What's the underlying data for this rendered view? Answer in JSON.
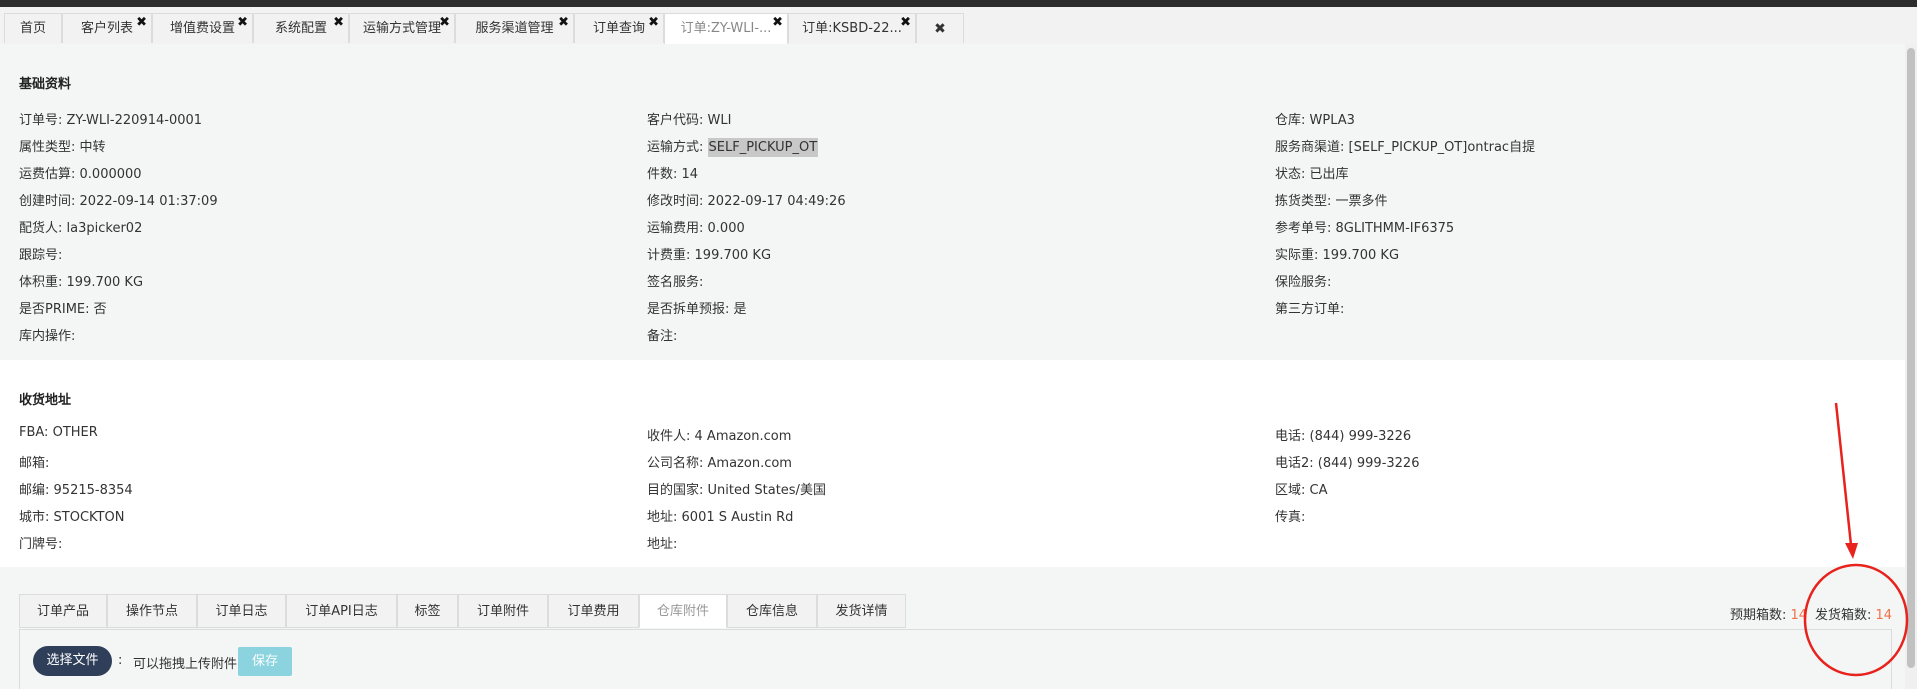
{
  "tabs": [
    {
      "label": "首页",
      "closable": false
    },
    {
      "label": "客户列表",
      "closable": true
    },
    {
      "label": "增值费设置",
      "closable": true
    },
    {
      "label": "系统配置",
      "closable": true
    },
    {
      "label": "运输方式管理",
      "closable": true
    },
    {
      "label": "服务渠道管理",
      "closable": true
    },
    {
      "label": "订单查询",
      "closable": true
    },
    {
      "label": "订单:ZY-WLI-...",
      "closable": true,
      "active": true
    },
    {
      "label": "订单:KSBD-22...",
      "closable": true
    },
    {
      "label": "✖",
      "closable": false
    }
  ],
  "close_glyph": "✖",
  "basic": {
    "title": "基础资料",
    "col1": [
      {
        "label": "订单号:",
        "value": "ZY-WLI-220914-0001"
      },
      {
        "label": "属性类型:",
        "value": "中转"
      },
      {
        "label": "运费估算:",
        "value": "0.000000"
      },
      {
        "label": "创建时间:",
        "value": "2022-09-14 01:37:09"
      },
      {
        "label": "配货人:",
        "value": "la3picker02"
      },
      {
        "label": "跟踪号:",
        "value": ""
      },
      {
        "label": "体积重:",
        "value": "199.700 KG"
      },
      {
        "label": "是否PRIME:",
        "value": "否"
      },
      {
        "label": "库内操作:",
        "value": ""
      }
    ],
    "col2": [
      {
        "label": "客户代码:",
        "value": "WLI"
      },
      {
        "label": "运输方式:",
        "value": "SELF_PICKUP_OT"
      },
      {
        "label": "件数:",
        "value": "14"
      },
      {
        "label": "修改时间:",
        "value": "2022-09-17 04:49:26"
      },
      {
        "label": "运输费用:",
        "value": "0.000"
      },
      {
        "label": "计费重:",
        "value": "199.700 KG"
      },
      {
        "label": "签名服务:",
        "value": ""
      },
      {
        "label": "是否拆单预报:",
        "value": "是"
      },
      {
        "label": "备注:",
        "value": ""
      }
    ],
    "col3": [
      {
        "label": "仓库:",
        "value": "WPLA3"
      },
      {
        "label": "服务商渠道:",
        "value": "[SELF_PICKUP_OT]ontrac自提"
      },
      {
        "label": "状态:",
        "value": "已出库"
      },
      {
        "label": "拣货类型:",
        "value": "一票多件"
      },
      {
        "label": "参考单号:",
        "value": "8GLITHMM-IF6375"
      },
      {
        "label": "实际重:",
        "value": "199.700 KG"
      },
      {
        "label": "保险服务:",
        "value": ""
      },
      {
        "label": "第三方订单:",
        "value": ""
      }
    ]
  },
  "address": {
    "title": "收货地址",
    "col1": [
      {
        "label": "FBA:",
        "value": "OTHER"
      },
      {
        "label": "邮箱:",
        "value": ""
      },
      {
        "label": "邮编:",
        "value": "95215-8354"
      },
      {
        "label": "城市:",
        "value": "STOCKTON"
      },
      {
        "label": "门牌号:",
        "value": ""
      }
    ],
    "col2": [
      {
        "label": "收件人:",
        "value": "4 Amazon.com"
      },
      {
        "label": "公司名称:",
        "value": "Amazon.com"
      },
      {
        "label": "目的国家:",
        "value": "United States/美国"
      },
      {
        "label": "地址:",
        "value": "6001 S Austin Rd"
      },
      {
        "label": "地址:",
        "value": ""
      }
    ],
    "col3": [
      {
        "label": "电话:",
        "value": "(844) 999-3226"
      },
      {
        "label": "电话2:",
        "value": "(844) 999-3226"
      },
      {
        "label": "区域:",
        "value": "CA"
      },
      {
        "label": "传真:",
        "value": ""
      }
    ]
  },
  "bottom_tabs": [
    "订单产品",
    "操作节点",
    "订单日志",
    "订单API日志",
    "标签",
    "订单附件",
    "订单费用",
    "仓库附件",
    "仓库信息",
    "发货详情"
  ],
  "active_bottom_tab": "仓库附件",
  "counts": {
    "expected_label": "预期箱数:",
    "expected_value": "14",
    "shipped_label": "发货箱数:",
    "shipped_value": "14"
  },
  "upload": {
    "choose_label": "选择文件",
    "separator": ":",
    "hint": "可以拖拽上传附件",
    "save_label": "保存"
  },
  "colors": {
    "accent_count": "#f07048",
    "annotation": "#e8221c",
    "file_button": "#2f3f5a",
    "save_button": "#8ad3df"
  }
}
